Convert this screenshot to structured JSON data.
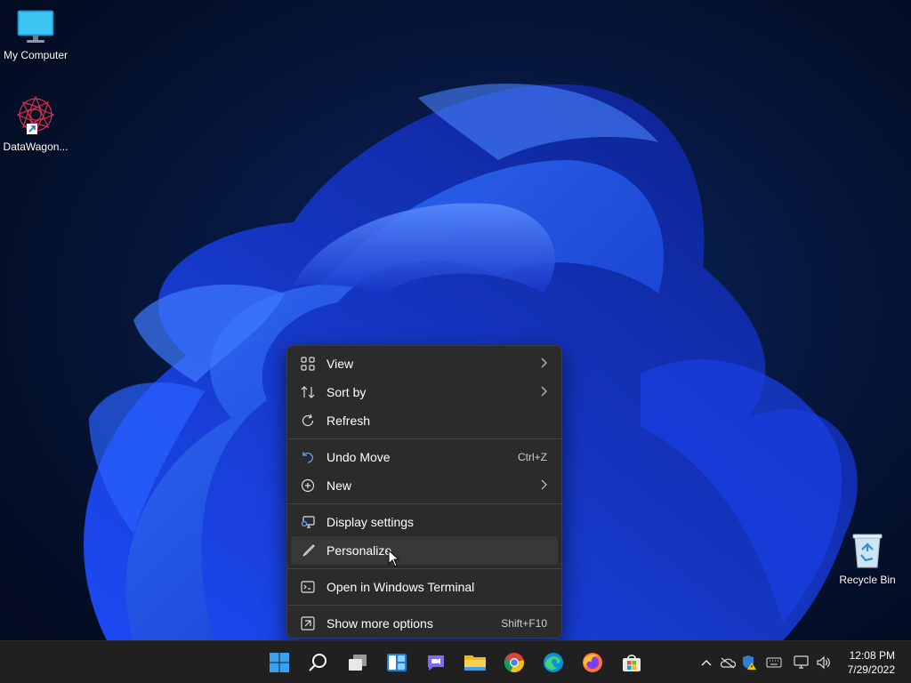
{
  "desktop": {
    "icons": [
      {
        "label": "My Computer",
        "icon": "monitor-icon"
      },
      {
        "label": "DataWagon...",
        "icon": "datawagon-shortcut-icon"
      },
      {
        "label": "Recycle Bin",
        "icon": "recycle-bin-icon"
      }
    ]
  },
  "context_menu": {
    "items": [
      {
        "label": "View",
        "icon": "view-grid-icon",
        "submenu": true
      },
      {
        "label": "Sort by",
        "icon": "sort-icon",
        "submenu": true
      },
      {
        "label": "Refresh",
        "icon": "refresh-icon"
      },
      {
        "label": "Undo Move",
        "icon": "undo-icon",
        "shortcut": "Ctrl+Z"
      },
      {
        "label": "New",
        "icon": "new-plus-icon",
        "submenu": true
      },
      {
        "label": "Display settings",
        "icon": "display-settings-icon"
      },
      {
        "label": "Personalize",
        "icon": "brush-icon",
        "highlighted": true
      },
      {
        "label": "Open in Windows Terminal",
        "icon": "terminal-icon"
      },
      {
        "label": "Show more options",
        "icon": "more-options-icon",
        "shortcut": "Shift+F10"
      }
    ]
  },
  "taskbar": {
    "apps": [
      "start-icon",
      "search-icon",
      "task-view-icon",
      "widgets-icon",
      "teams-chat-icon",
      "file-explorer-icon",
      "chrome-icon",
      "edge-icon",
      "firefox-icon",
      "store-icon"
    ],
    "tray": [
      "chevron-up-icon",
      "onedrive-icon",
      "security-warning-icon",
      "keyboard-icon",
      "network-icon",
      "volume-icon"
    ],
    "clock": {
      "time": "12:08 PM",
      "date": "7/29/2022"
    }
  },
  "colors": {
    "accent": "#2a5bff",
    "menu_bg": "#2b2b2b",
    "taskbar_bg": "#202020"
  }
}
